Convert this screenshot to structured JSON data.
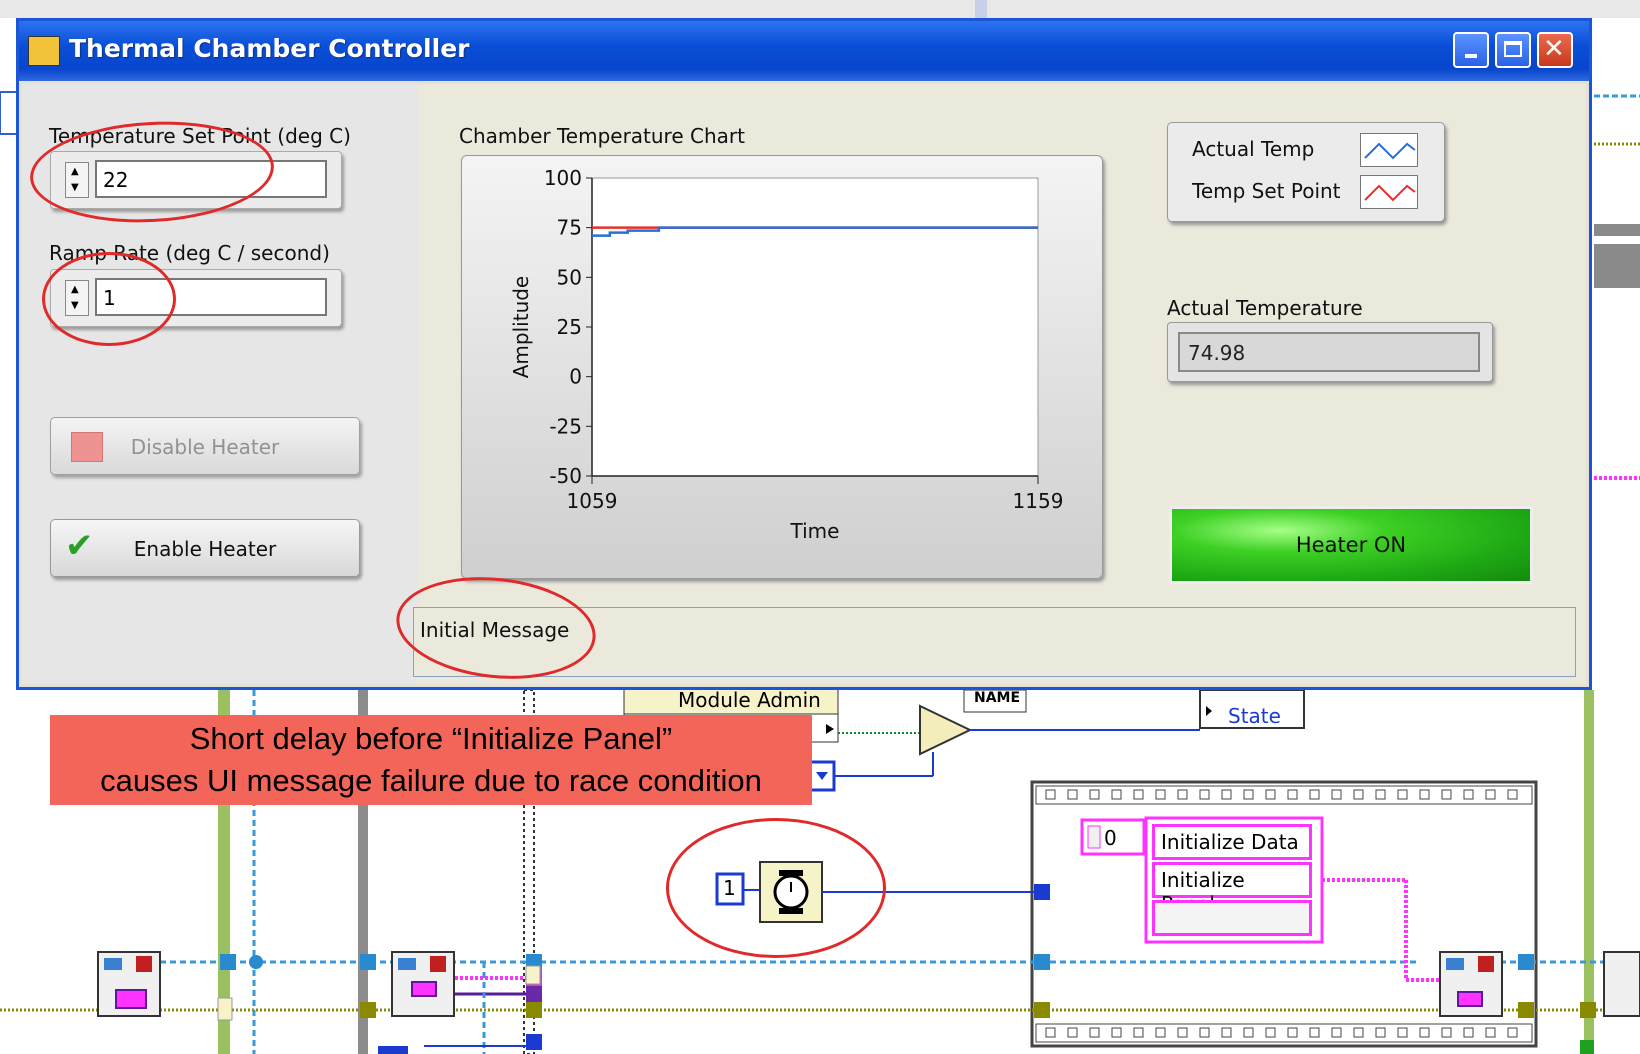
{
  "window": {
    "title": "Thermal Chamber Controller"
  },
  "controls": {
    "setpoint": {
      "label": "Temperature Set Point (deg C)",
      "value": "22"
    },
    "ramp_rate": {
      "label": "Ramp Rate (deg C / second)",
      "value": "1"
    },
    "disable_button_label": "Disable Heater",
    "enable_button_label": "Enable Heater"
  },
  "chart": {
    "label": "Chamber Temperature Chart"
  },
  "legend": {
    "items": [
      {
        "label": "Actual Temp",
        "color": "#2a6fd6"
      },
      {
        "label": "Temp Set Point",
        "color": "#e8302a"
      }
    ]
  },
  "indicators": {
    "actual_temp_label": "Actual Temperature",
    "actual_temp_value": "74.98",
    "heater_status": "Heater ON",
    "status_message": "Initial Message"
  },
  "annotation": {
    "line1": "Short delay before “Initialize Panel”",
    "line2": "causes UI message failure due to race condition"
  },
  "block_diagram": {
    "module_admin": "Module Admin",
    "name_label": "NAME",
    "state_label": "State",
    "wait_constant": "1",
    "array_index": "0",
    "case_items": [
      "Initialize Data",
      "Initialize Panel",
      ""
    ]
  },
  "chart_data": {
    "type": "line",
    "xlabel": "Time",
    "ylabel": "Amplitude",
    "xlim": [
      1059,
      1159
    ],
    "ylim": [
      -50,
      100
    ],
    "yticks": [
      100,
      75,
      50,
      25,
      0,
      -25,
      -50
    ],
    "xticks": [
      1059,
      1159
    ],
    "series": [
      {
        "name": "Actual Temp",
        "color": "#2a6fd6",
        "x": [
          1059,
          1063,
          1063,
          1067,
          1067,
          1074,
          1074,
          1159
        ],
        "y": [
          71,
          71,
          72.5,
          72.5,
          73.5,
          73.5,
          75,
          75
        ]
      },
      {
        "name": "Temp Set Point",
        "color": "#e8302a",
        "x": [
          1059,
          1159
        ],
        "y": [
          75,
          75
        ]
      }
    ]
  }
}
